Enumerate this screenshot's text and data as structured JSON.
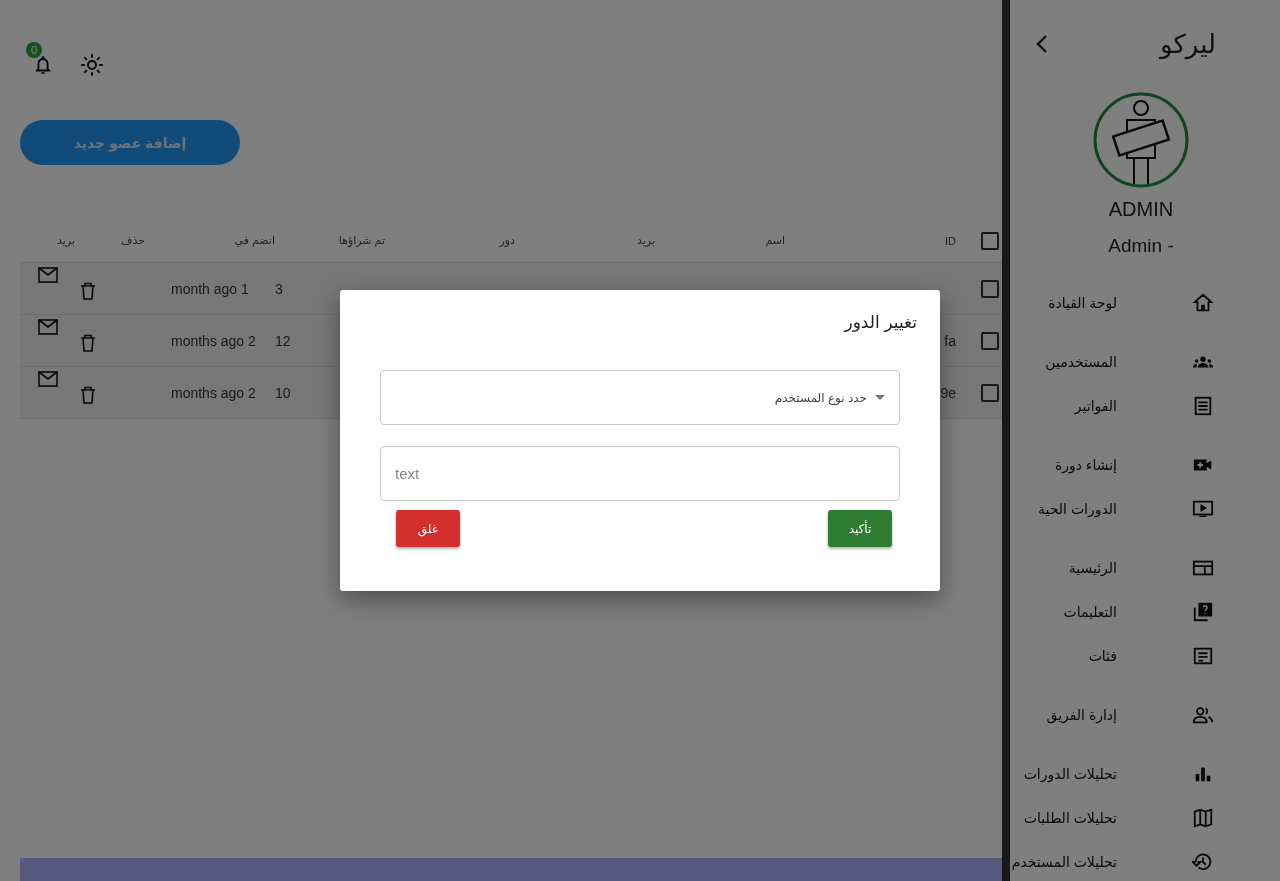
{
  "topbar": {
    "notification_count": "0"
  },
  "add_button": "إضافة عضو جديد",
  "table": {
    "header_checked": false,
    "columns": [
      "ID",
      "اسم",
      "بريد",
      "دور",
      "تم شراؤها",
      "انضم في",
      "حذف",
      "بريد"
    ],
    "rows": [
      {
        "checked": false,
        "purchased": "3",
        "joined": "month ago 1"
      },
      {
        "checked": false,
        "id": "fa",
        "purchased": "12",
        "joined": "months ago 2"
      },
      {
        "checked": false,
        "id": "9e",
        "purchased": "10",
        "joined": "months ago 2"
      }
    ]
  },
  "sidebar": {
    "title": "ليركو",
    "user_name": "ADMIN",
    "user_role": "Admin -",
    "groups": [
      [
        {
          "label": "لوحة القيادة",
          "kind": "home"
        }
      ],
      [
        {
          "label": "المستخدمين",
          "kind": "people"
        },
        {
          "label": "الفواتير",
          "kind": "list"
        }
      ],
      [
        {
          "label": "إنشاء دورة",
          "kind": "video"
        },
        {
          "label": "الدورات الحية",
          "kind": "tv"
        }
      ],
      [
        {
          "label": "الرئيسية",
          "kind": "layout"
        },
        {
          "label": "التعليمات",
          "kind": "help"
        },
        {
          "label": "فئات",
          "kind": "note"
        }
      ],
      [
        {
          "label": "إدارة الفريق",
          "kind": "team"
        }
      ],
      [
        {
          "label": "تحليلات الدورات",
          "kind": "chart"
        },
        {
          "label": "تحليلات الطلبات",
          "kind": "map"
        },
        {
          "label": "تحليلات المستخدم",
          "kind": "history"
        }
      ]
    ]
  },
  "dialog": {
    "title": "تغيير الدور",
    "select_placeholder": "حدد نوع المستخدم",
    "input_placeholder": "text",
    "close_button": "غلق",
    "confirm_button": "تأكيد"
  }
}
